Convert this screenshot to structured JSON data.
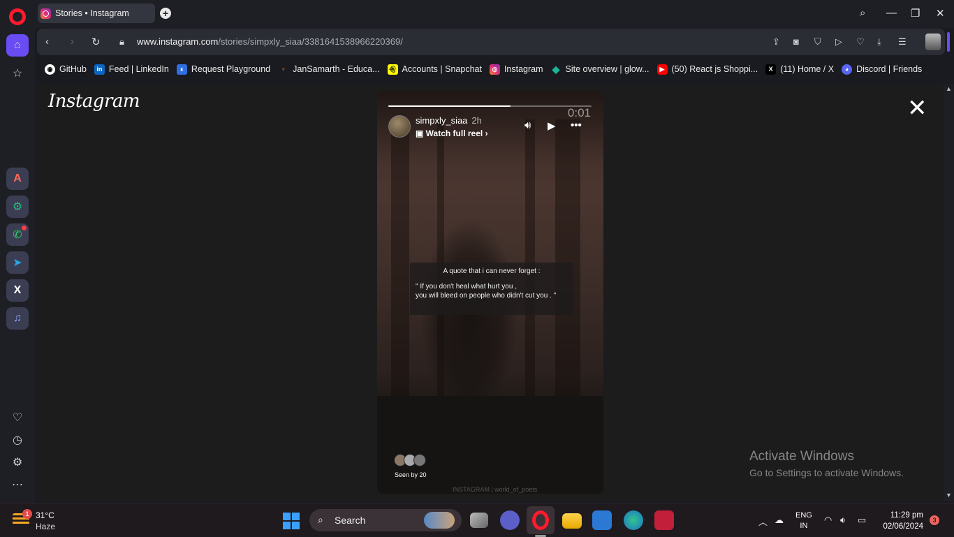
{
  "browser": {
    "tab_title": "Stories • Instagram",
    "new_tab_label": "+",
    "url_domain": "www.instagram.com",
    "url_path": "/stories/simpxly_siaa/3381641538966220369/"
  },
  "bookmarks": [
    {
      "label": "GitHub",
      "icon": "github-icon",
      "color": "#ffffff"
    },
    {
      "label": "Feed | LinkedIn",
      "icon": "linkedin-icon",
      "color": "#0a66c2"
    },
    {
      "label": "Request Playground",
      "icon": "playground-icon",
      "color": "#2f6fe4"
    },
    {
      "label": "JanSamarth - Educa...",
      "icon": "jansamarth-icon",
      "color": "#e8772e"
    },
    {
      "label": "Accounts | Snapchat",
      "icon": "snapchat-icon",
      "color": "#fffc00"
    },
    {
      "label": "Instagram",
      "icon": "instagram-icon",
      "color": "#dd2a7b"
    },
    {
      "label": "Site overview | glow...",
      "icon": "diamond-icon",
      "color": "#1bb39a"
    },
    {
      "label": "(50) React js Shoppi...",
      "icon": "youtube-icon",
      "color": "#ff0000"
    },
    {
      "label": "(11) Home / X",
      "icon": "x-icon",
      "color": "#000000"
    },
    {
      "label": "Discord | Friends",
      "icon": "discord-icon",
      "color": "#5865f2"
    }
  ],
  "instagram": {
    "logo": "Instagram",
    "close_glyph": "✕"
  },
  "story": {
    "username": "simpxly_siaa",
    "age": "2h",
    "reel_label": "Watch full reel",
    "timer": "0:01",
    "progress": 0.6,
    "quote_title": "A quote that i can never forget :",
    "quote_line1": "\" If you don't heal what hurt you ,",
    "quote_line2": "you will bleed on people who didn't cut you . \"",
    "seen_by": "Seen by 20",
    "watermark": "INSTAGRAM | world_of_poets"
  },
  "windows_notice": {
    "line1": "Activate Windows",
    "line2": "Go to Settings to activate Windows."
  },
  "taskbar": {
    "weather_badge": "1",
    "temperature": "31°C",
    "weather": "Haze",
    "search_label": "Search",
    "lang1": "ENG",
    "lang2": "IN",
    "time": "11:29 pm",
    "date": "02/06/2024",
    "notifications": "3"
  }
}
